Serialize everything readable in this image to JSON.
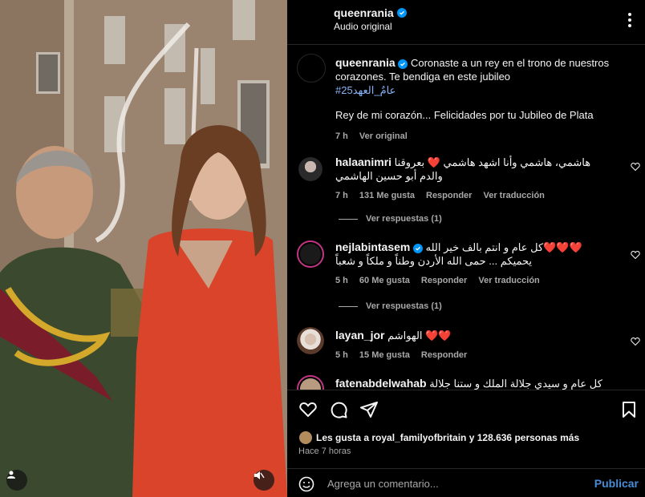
{
  "post": {
    "username": "queenrania",
    "audio_label": "Audio original"
  },
  "caption": {
    "username": "queenrania",
    "text": "Coronaste a un rey en el trono de nuestros corazones. Te bendiga en este jubileo",
    "hashtag": "#25عامٌ_العهد",
    "translation": "Rey de mi corazón... Felicidades por tu Jubileo de Plata",
    "time": "7 h",
    "see_original": "Ver original"
  },
  "comments": [
    {
      "username": "halaanimri",
      "text": "هاشمي، هاشمي وأنا اشهد هاشمي ❤️ بعروقنا والدم أبو حسين الهاشمي",
      "time": "7 h",
      "likes": "131 Me gusta",
      "reply": "Responder",
      "translate": "Ver traducción",
      "view_replies": "Ver respuestas (1)"
    },
    {
      "username": "nejlabintasem",
      "text": "❤️❤️❤️كل عام و انتم بالف خير الله يحميكم ... حمى الله الأردن وطناً و ملكاً و شعباً",
      "time": "5 h",
      "likes": "60 Me gusta",
      "reply": "Responder",
      "translate": "Ver traducción",
      "view_replies": "Ver respuestas (1)"
    },
    {
      "username": "layan_jor",
      "text": "❤️❤️ الهواشم",
      "time": "5 h",
      "likes": "15 Me gusta",
      "reply": "Responder"
    },
    {
      "username": "fatenabdelwahab",
      "text": "كل عام و سيدي جلالة الملك و ستنا جلالة الملكة بالف"
    }
  ],
  "actions": {
    "likes_text": "Les gusta a royal_familyofbritain y 128.636 personas más",
    "time_ago": "Hace 7 horas"
  },
  "add_comment": {
    "placeholder": "Agrega un comentario...",
    "publish": "Publicar"
  },
  "colors": {
    "background": "#000000",
    "accent": "#0095f6",
    "publish": "#4a8bd6",
    "heart": "#ed4956"
  }
}
